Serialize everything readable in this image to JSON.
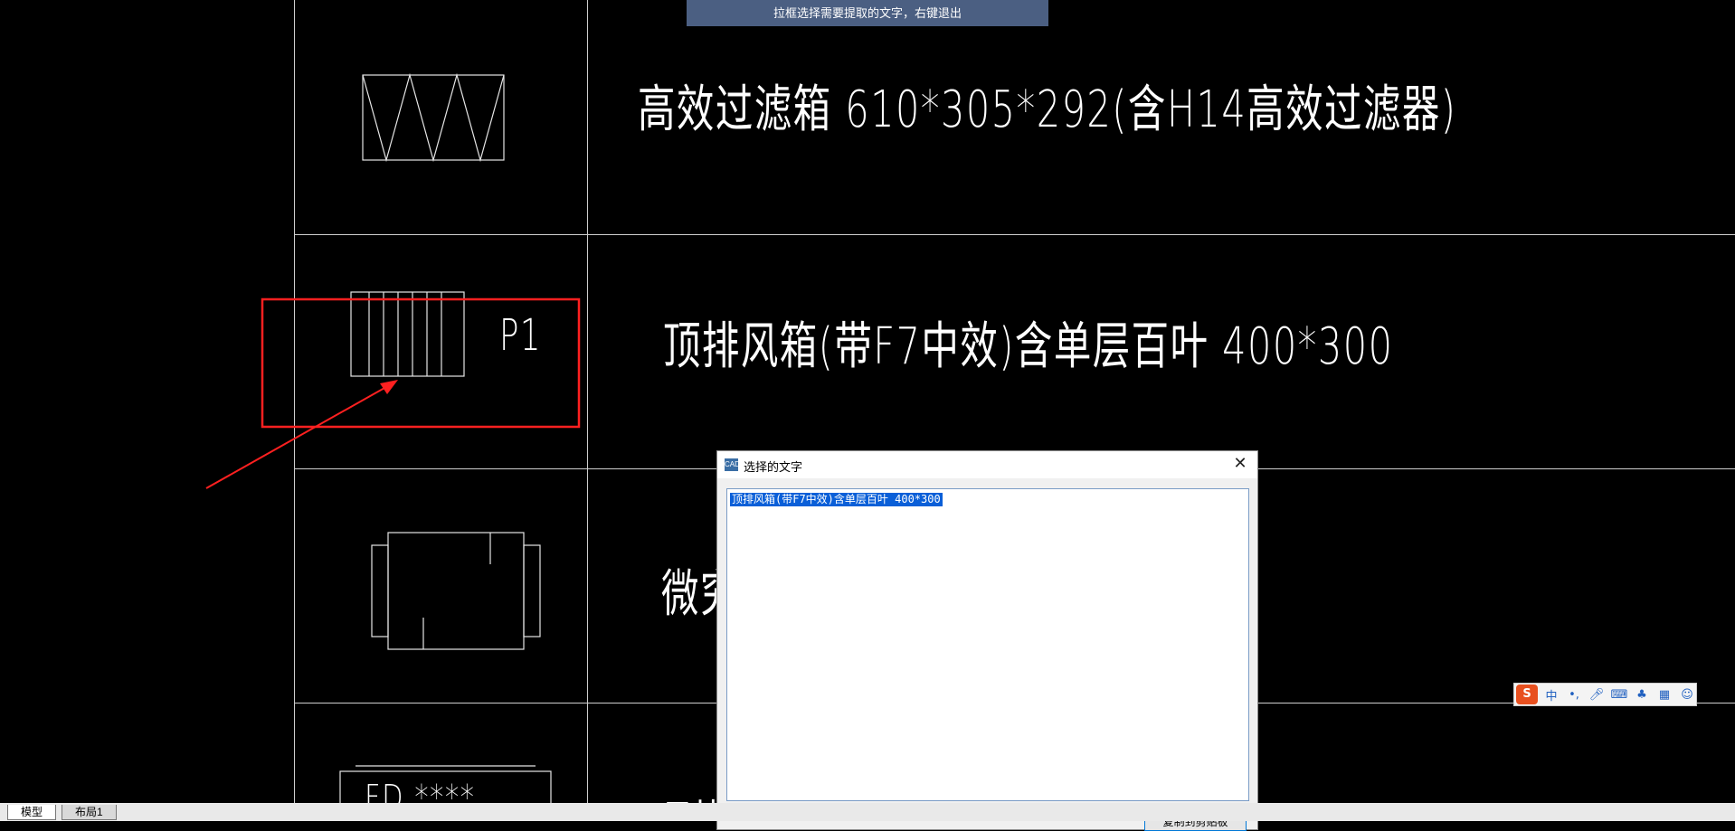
{
  "prompt": "拉框选择需要提取的文字，右键退出",
  "drawing": {
    "row1_text": "高效过滤箱 610*305*292(含H14高效过滤器)",
    "row2_label": "P1",
    "row2_text": "顶排风箱(带F7中效)含单层百叶 400*300",
    "row3_text_partial": "微究",
    "row4_symbol_text": "FD ****",
    "row4_text_partial": "日比"
  },
  "dialog": {
    "title": "选择的文字",
    "text": "顶排风箱(带F7中效)含单层百叶 400*300",
    "copy_button": "复制到剪贴板"
  },
  "ime": {
    "logo": "S",
    "mode": "中"
  },
  "tabs": [
    {
      "label": "模型"
    },
    {
      "label": "布局1"
    }
  ],
  "colors": {
    "background": "#000000",
    "lines": "#cfcfcf",
    "prompt_bar": "#4b5f82",
    "annotation": "#ff2020",
    "selection": "#0a5fd8"
  }
}
